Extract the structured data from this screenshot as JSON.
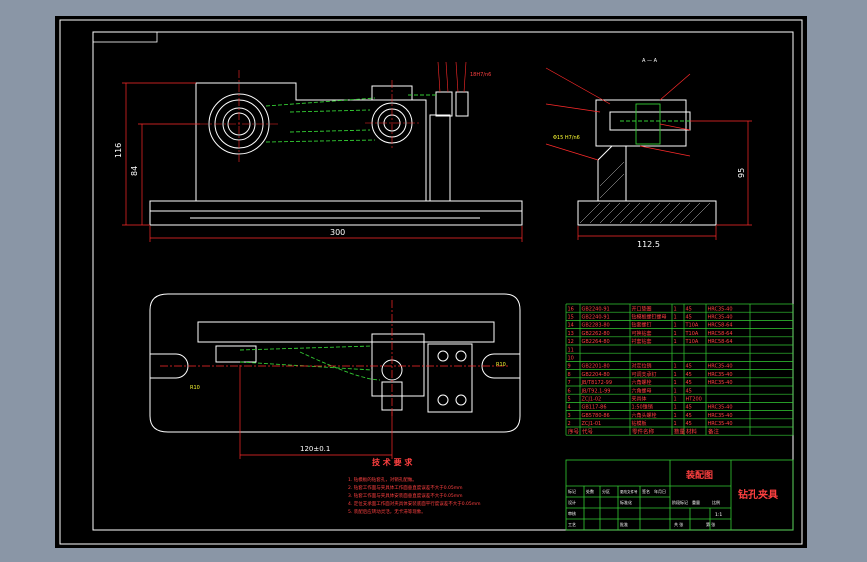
{
  "colors": {
    "background": "#8a96a6",
    "sheet": "#000000",
    "outline": "#ffffff",
    "dimension": "#ff2a2a",
    "hidden": "#33cc33",
    "table_line": "#33cc33",
    "text_red": "#ff4040",
    "text_white": "#ffffff",
    "highlight": "#ffff33"
  },
  "dims": {
    "front_width": "300",
    "front_height_116": "116",
    "front_height_84": "84",
    "side_width": "112.5",
    "side_height": "95",
    "plan_length": "120±0.1",
    "radius_left": "R10",
    "radius_right": "R10",
    "section_label": "A — A",
    "fit_label": "18H7/n6",
    "phi_label": "Φ15 H7/n6"
  },
  "tech": {
    "title": "技 术 要 求",
    "items": [
      "1. 钻模板的钻套孔，对销孔配做。",
      "2. 钻套工作面与夹具体工作面垂直度误差不大于0.05mm",
      "3. 钻套工作面与夹具体安装面垂直度误差不大于0.05mm",
      "4. 定位支承面工作面对夹具体安装底面平行度误差不大于0.05mm",
      "5. 装配后应转动灵活，无卡滞等现象。"
    ]
  },
  "bom": {
    "rows": [
      {
        "no": "16",
        "code": "GB2240-91",
        "name": "开口垫圈",
        "qty": "1",
        "mat": "45",
        "note": "HRC35-40"
      },
      {
        "no": "15",
        "code": "GB2240-91",
        "name": "钻模板螺钉螺母",
        "qty": "1",
        "mat": "45",
        "note": "HRC35-40"
      },
      {
        "no": "14",
        "code": "GB2283-80",
        "name": "钻套螺钉",
        "qty": "1",
        "mat": "T10A",
        "note": "HRC58-64"
      },
      {
        "no": "13",
        "code": "GB2262-80",
        "name": "可换钻套",
        "qty": "1",
        "mat": "T10A",
        "note": "HRC58-64"
      },
      {
        "no": "12",
        "code": "GB2264-80",
        "name": "衬套钻套",
        "qty": "1",
        "mat": "T10A",
        "note": "HRC58-64"
      },
      {
        "no": "11",
        "code": "",
        "name": "",
        "qty": "",
        "mat": "",
        "note": ""
      },
      {
        "no": "10",
        "code": "",
        "name": "",
        "qty": "",
        "mat": "",
        "note": ""
      },
      {
        "no": "9",
        "code": "GB2201-80",
        "name": "对定位销",
        "qty": "1",
        "mat": "45",
        "note": "HRC35-40"
      },
      {
        "no": "8",
        "code": "GB2204-80",
        "name": "可调支承钉",
        "qty": "1",
        "mat": "45",
        "note": "HRC35-40"
      },
      {
        "no": "7",
        "code": "JB/T8172-99",
        "name": "六角螺栓",
        "qty": "1",
        "mat": "45",
        "note": "HRC35-40"
      },
      {
        "no": "6",
        "code": "JB/T92.1-99",
        "name": "六角螺母",
        "qty": "1",
        "mat": "45",
        "note": ""
      },
      {
        "no": "5",
        "code": "ZCJ1-02",
        "name": "夹具体",
        "qty": "1",
        "mat": "HT200",
        "note": ""
      },
      {
        "no": "4",
        "code": "GB117-86",
        "name": "1:50锥销",
        "qty": "1",
        "mat": "45",
        "note": "HRC35-40"
      },
      {
        "no": "3",
        "code": "GB5780-86",
        "name": "六角头螺栓",
        "qty": "1",
        "mat": "45",
        "note": "HRC35-40"
      },
      {
        "no": "2",
        "code": "ZCJ1-01",
        "name": "钻模板",
        "qty": "1",
        "mat": "45",
        "note": "HRC35-40"
      }
    ],
    "header": {
      "no": "序号",
      "code": "代号",
      "name": "零件名称",
      "qty": "数量",
      "mat": "材料",
      "note": "备注"
    }
  },
  "title_block": {
    "drawing_name": "装配图",
    "part_name": "钻孔夹具",
    "scale": "1:1",
    "labels": [
      "标记",
      "处数",
      "分区",
      "更改文件号",
      "签名",
      "年月日",
      "设计",
      "标准化",
      "审核",
      "工艺",
      "批准",
      "阶段标记",
      "重量",
      "比例",
      "共 张",
      "第 张"
    ]
  }
}
